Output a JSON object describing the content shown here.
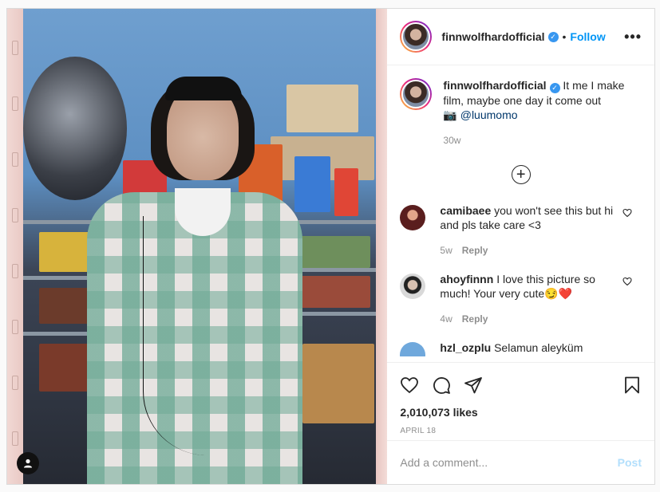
{
  "header": {
    "username": "finnwolfhardofficial",
    "verified_icon": "check",
    "separator": "•",
    "follow_label": "Follow",
    "more_label": "•••"
  },
  "caption": {
    "username": "finnwolfhardofficial",
    "text": "It me I make film, maybe one day it come out",
    "camera_emoji": "📷",
    "mention": "@luumomo",
    "time": "30w"
  },
  "load_more_label": "+",
  "comments": [
    {
      "username": "camibaee",
      "text": "you won't see this but hi and pls take care <3",
      "time": "5w",
      "reply_label": "Reply",
      "avatar_color": "#5a1e1e"
    },
    {
      "username": "ahoyfinnn",
      "text": "I love this picture so much! Your very cute😏❤️",
      "time": "4w",
      "reply_label": "Reply",
      "avatar_color": "#cfcfcf"
    },
    {
      "username": "hzl_ozplu",
      "text": "Selamun aleyküm",
      "avatar_color": "#6fa8dc"
    }
  ],
  "likes": "2,010,073 likes",
  "date": "APRIL 18",
  "add_comment": {
    "placeholder": "Add a comment...",
    "post_label": "Post"
  },
  "colors": {
    "accent": "#0095f6",
    "verified": "#3897f0",
    "post_disabled": "#b2dffc",
    "meta_gray": "#8e8e8e"
  },
  "icons": [
    "heart-icon",
    "comment-icon",
    "share-icon",
    "bookmark-icon",
    "user-icon",
    "add-circle-icon",
    "more-icon"
  ]
}
